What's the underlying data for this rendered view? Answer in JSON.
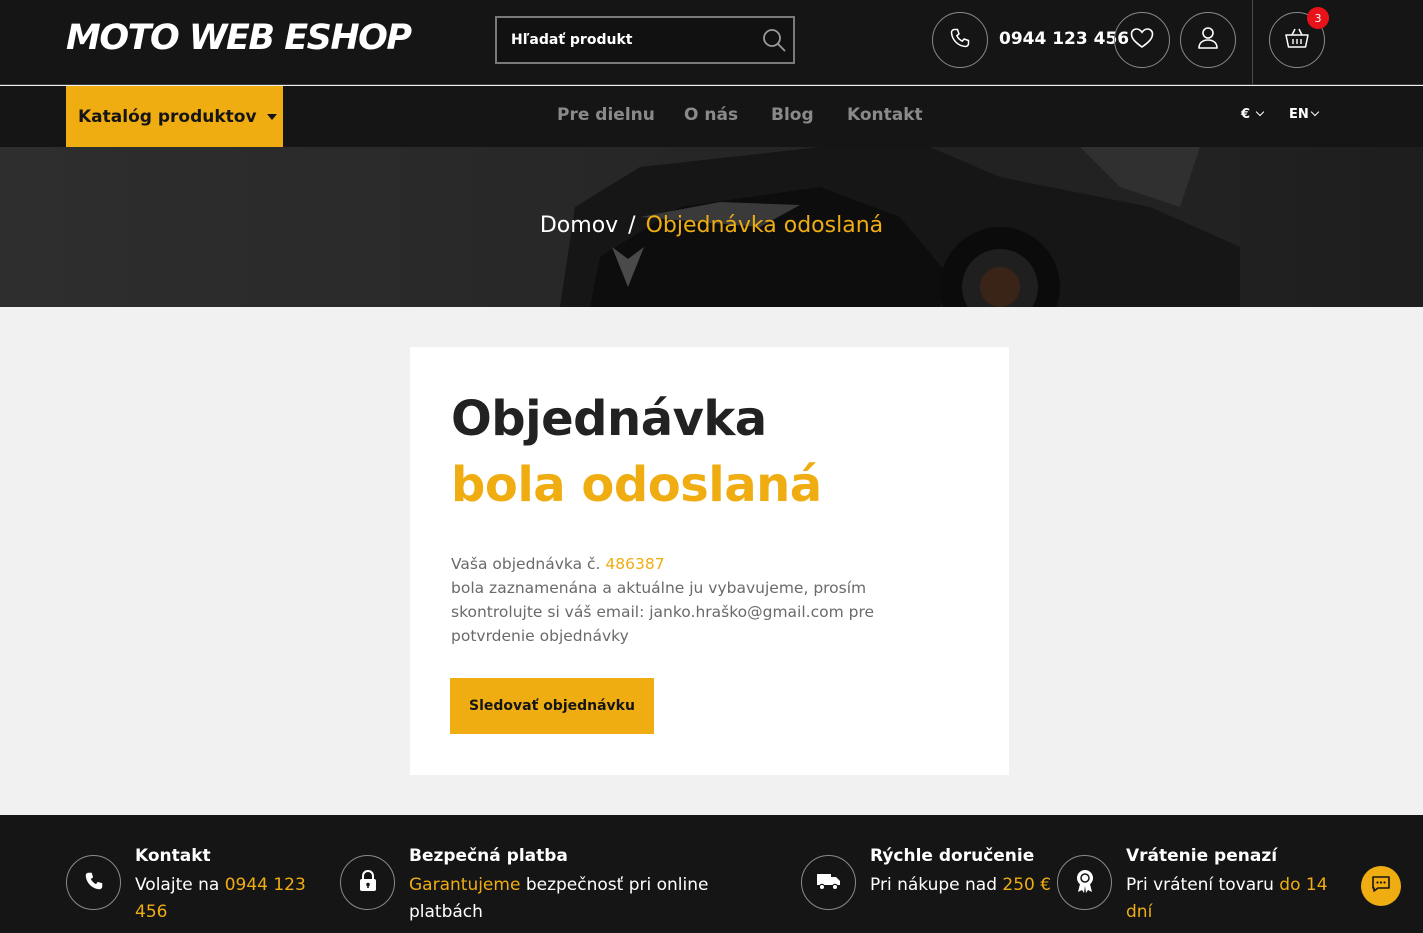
{
  "header": {
    "logo": "MOTO WEB ESHOP",
    "search_placeholder": "Hľadať produkt",
    "phone": "0944 123 456",
    "cart_count": "3"
  },
  "nav": {
    "catalog": "Katalóg produktov",
    "links": [
      "Pre dielnu",
      "O nás",
      "Blog",
      "Kontakt"
    ],
    "currency": "€",
    "language": "EN"
  },
  "breadcrumb": {
    "home": "Domov",
    "separator": "/",
    "current": "Objednávka odoslaná"
  },
  "confirmation": {
    "title_line1": "Objednávka",
    "title_line2": "bola odoslaná",
    "order_prefix": "Vaša objednávka č.",
    "order_number": "486387",
    "message": "bola zaznamenána a aktuálne ju vybavujeme, prosím skontrolujte si váš email: janko.hraško@gmail.com pre potvrdenie objednávky",
    "button": "Sledovať objednávku"
  },
  "features": [
    {
      "icon": "phone-icon",
      "title": "Kontakt",
      "text_plain": "Volajte na",
      "text_highlight": "0944 123 456"
    },
    {
      "icon": "lock-icon",
      "title": "Bezpečná platba",
      "text_highlight": "Garantujeme",
      "text_plain": "bezpečnosť pri online platbách"
    },
    {
      "icon": "truck-icon",
      "title": "Rýchle doručenie",
      "text_plain": "Pri nákupe nad",
      "text_highlight": "250 €"
    },
    {
      "icon": "award-icon",
      "title": "Vrátenie penazí",
      "text_plain": "Pri vrátení tovaru",
      "text_highlight": "do 14 dní"
    }
  ],
  "colors": {
    "accent": "#efad12",
    "dark": "#151515",
    "badge": "#e8121b"
  }
}
